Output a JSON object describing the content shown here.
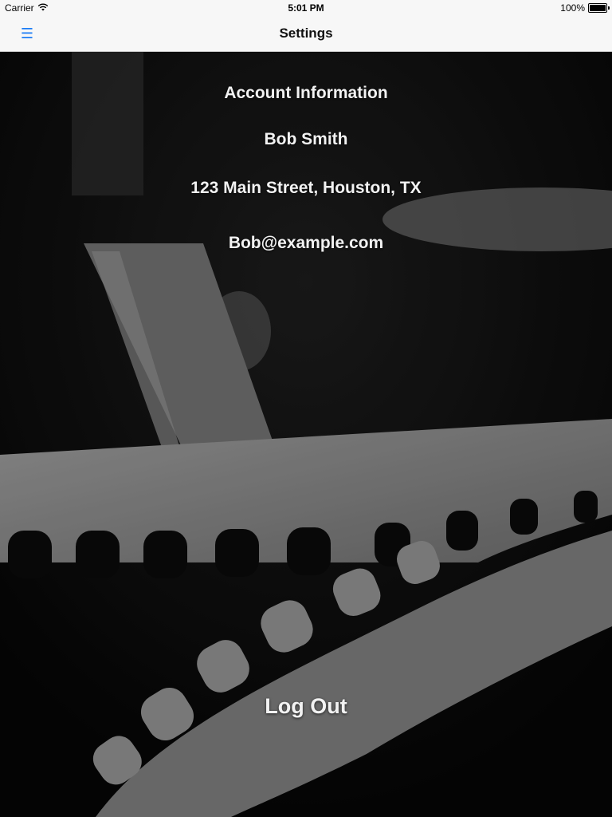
{
  "status_bar": {
    "carrier": "Carrier",
    "time": "5:01 PM",
    "battery": "100%"
  },
  "nav": {
    "title": "Settings",
    "menu_icon": "hamburger-menu-icon",
    "accent_color": "#1b7cf5"
  },
  "account": {
    "heading": "Account Information",
    "name": "Bob Smith",
    "address": "123 Main Street, Houston, TX",
    "email": "Bob@example.com"
  },
  "actions": {
    "logout_label": "Log Out"
  }
}
